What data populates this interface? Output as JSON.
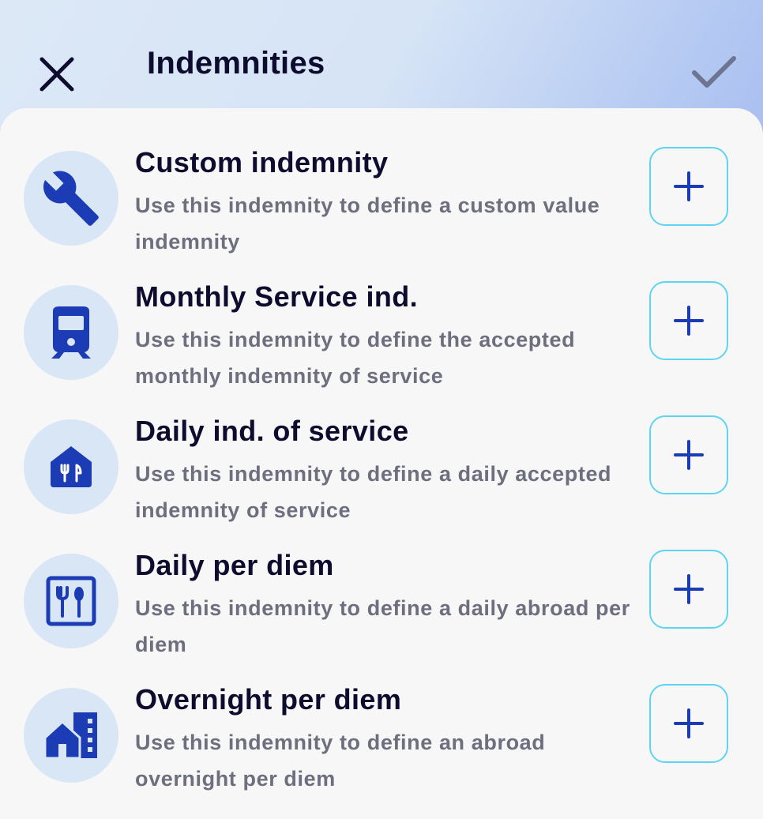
{
  "header": {
    "title": "Indemnities",
    "close_icon": "close-icon",
    "confirm_icon": "check-icon"
  },
  "colors": {
    "title": "#0d0b2e",
    "description": "#6d6e7e",
    "icon": "#1b3cb5",
    "icon_bg": "#d8e6f5",
    "button_border": "#5dd5f2",
    "sheet_bg": "#f7f7f8"
  },
  "items": [
    {
      "title": "Custom indemnity",
      "description": "Use this indemnity to define a custom value indemnity",
      "icon": "wrench-icon",
      "add_icon": "plus-icon"
    },
    {
      "title": "Monthly Service ind.",
      "description": "Use this indemnity to define the accepted monthly indemnity of service",
      "icon": "train-icon",
      "add_icon": "plus-icon"
    },
    {
      "title": "Daily ind. of service",
      "description": "Use this indemnity to define a daily accepted indemnity of service",
      "icon": "restaurant-house-icon",
      "add_icon": "plus-icon"
    },
    {
      "title": "Daily per diem",
      "description": "Use this indemnity to define a daily abroad per diem",
      "icon": "dining-icon",
      "add_icon": "plus-icon"
    },
    {
      "title": "Overnight per diem",
      "description": "Use this indemnity to define an abroad overnight per diem",
      "icon": "house-building-icon",
      "add_icon": "plus-icon"
    }
  ]
}
